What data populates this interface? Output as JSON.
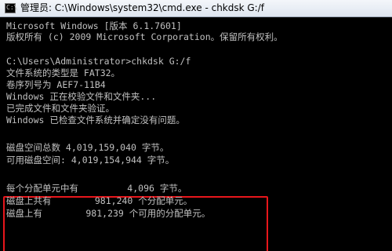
{
  "window": {
    "title": "管理员: C:\\Windows\\system32\\cmd.exe - chkdsk  G:/f",
    "icon_glyph": "C:\\"
  },
  "console": {
    "lines": [
      "Microsoft Windows [版本 6.1.7601]",
      "版权所有 (c) 2009 Microsoft Corporation。保留所有权利。",
      "",
      "C:\\Users\\Administrator>chkdsk G:/f",
      "文件系统的类型是 FAT32。",
      "卷序列号为 AEF7-11B4",
      "Windows 正在校验文件和文件夹...",
      "已完成文件和文件夹验证。",
      "Windows 已检查文件系统并确定没有问题。",
      "",
      "磁盘空间总数 4,019,159,040 字节。",
      "可用磁盘空间: 4,019,154,944 字节。",
      "",
      "每个分配单元中有         4,096 字节。",
      "磁盘上共有        981,240 个分配单元。",
      "磁盘上有        981,239 个可用的分配单元。"
    ]
  },
  "colors": {
    "console_bg": "#000000",
    "console_text": "#c0c0c0",
    "highlight_border": "#e8161b"
  },
  "icons": {
    "app": "cmd-prompt-icon"
  }
}
